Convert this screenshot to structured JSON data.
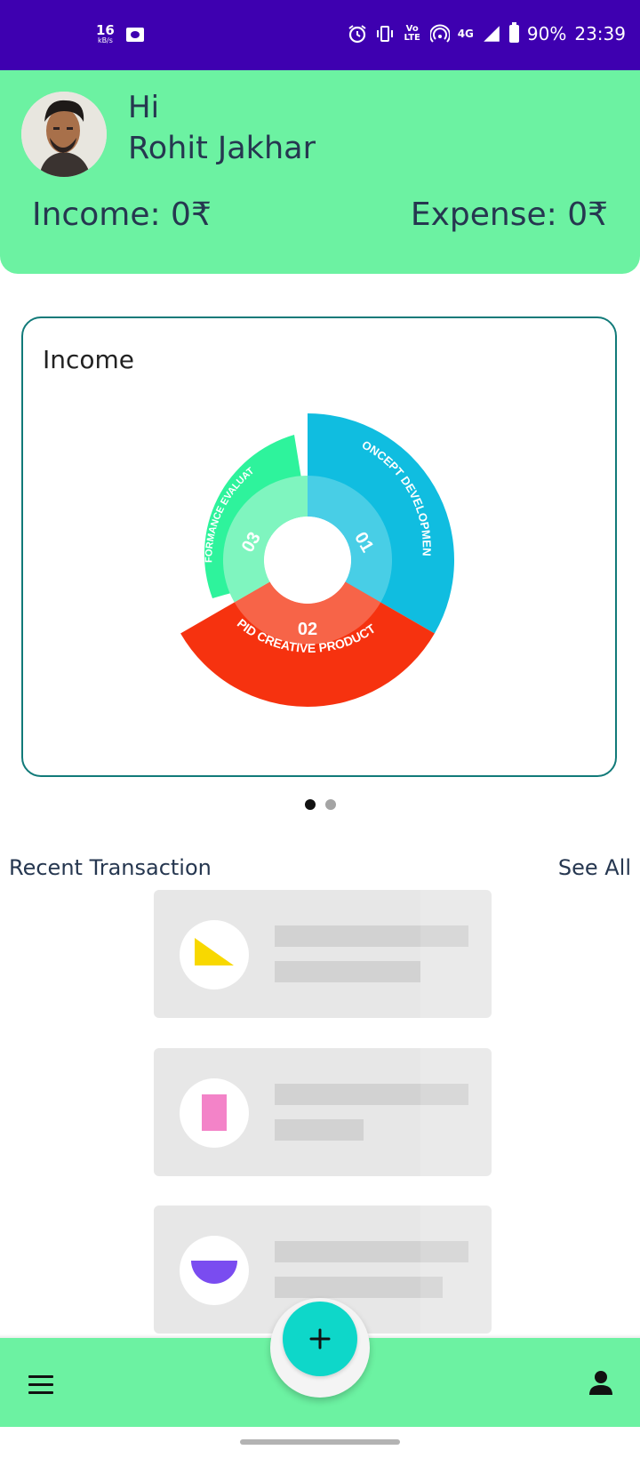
{
  "status_bar": {
    "net_speed": "16",
    "net_unit": "kB/s",
    "volte": "Vo LTE",
    "network": "4G",
    "battery": "90%",
    "time": "23:39"
  },
  "header": {
    "greeting": "Hi",
    "user_name": "Rohit Jakhar",
    "income_label": "Income: 0₹",
    "expense_label": "Expense: 0₹"
  },
  "chart_card": {
    "title": "Income"
  },
  "chart_data": {
    "type": "pie",
    "title": "Income",
    "series": [
      {
        "number": "01",
        "label": "CONCEPT DEVELOPMENT",
        "color": "#10bde0",
        "inner_color": "#48cee6"
      },
      {
        "number": "02",
        "label": "RAPID CREATIVE PRODUCTION",
        "color": "#f6320f",
        "inner_color": "#f76448"
      },
      {
        "number": "03",
        "label": "PERFORMANCE EVALUATION",
        "color": "#2ef39c",
        "inner_color": "#7ff5bf"
      }
    ]
  },
  "carousel": {
    "count": 2,
    "active": 0
  },
  "recent": {
    "title": "Recent Transaction",
    "see_all": "See All",
    "items": [
      {
        "icon": "triangle-icon",
        "color": "#f8d800"
      },
      {
        "icon": "rectangle-icon",
        "color": "#f383c8"
      },
      {
        "icon": "half-circle-icon",
        "color": "#7a4cf0"
      }
    ]
  },
  "bottom_nav": {
    "menu_icon": "menu-icon",
    "add_icon": "plus-icon",
    "profile_icon": "person-icon"
  }
}
